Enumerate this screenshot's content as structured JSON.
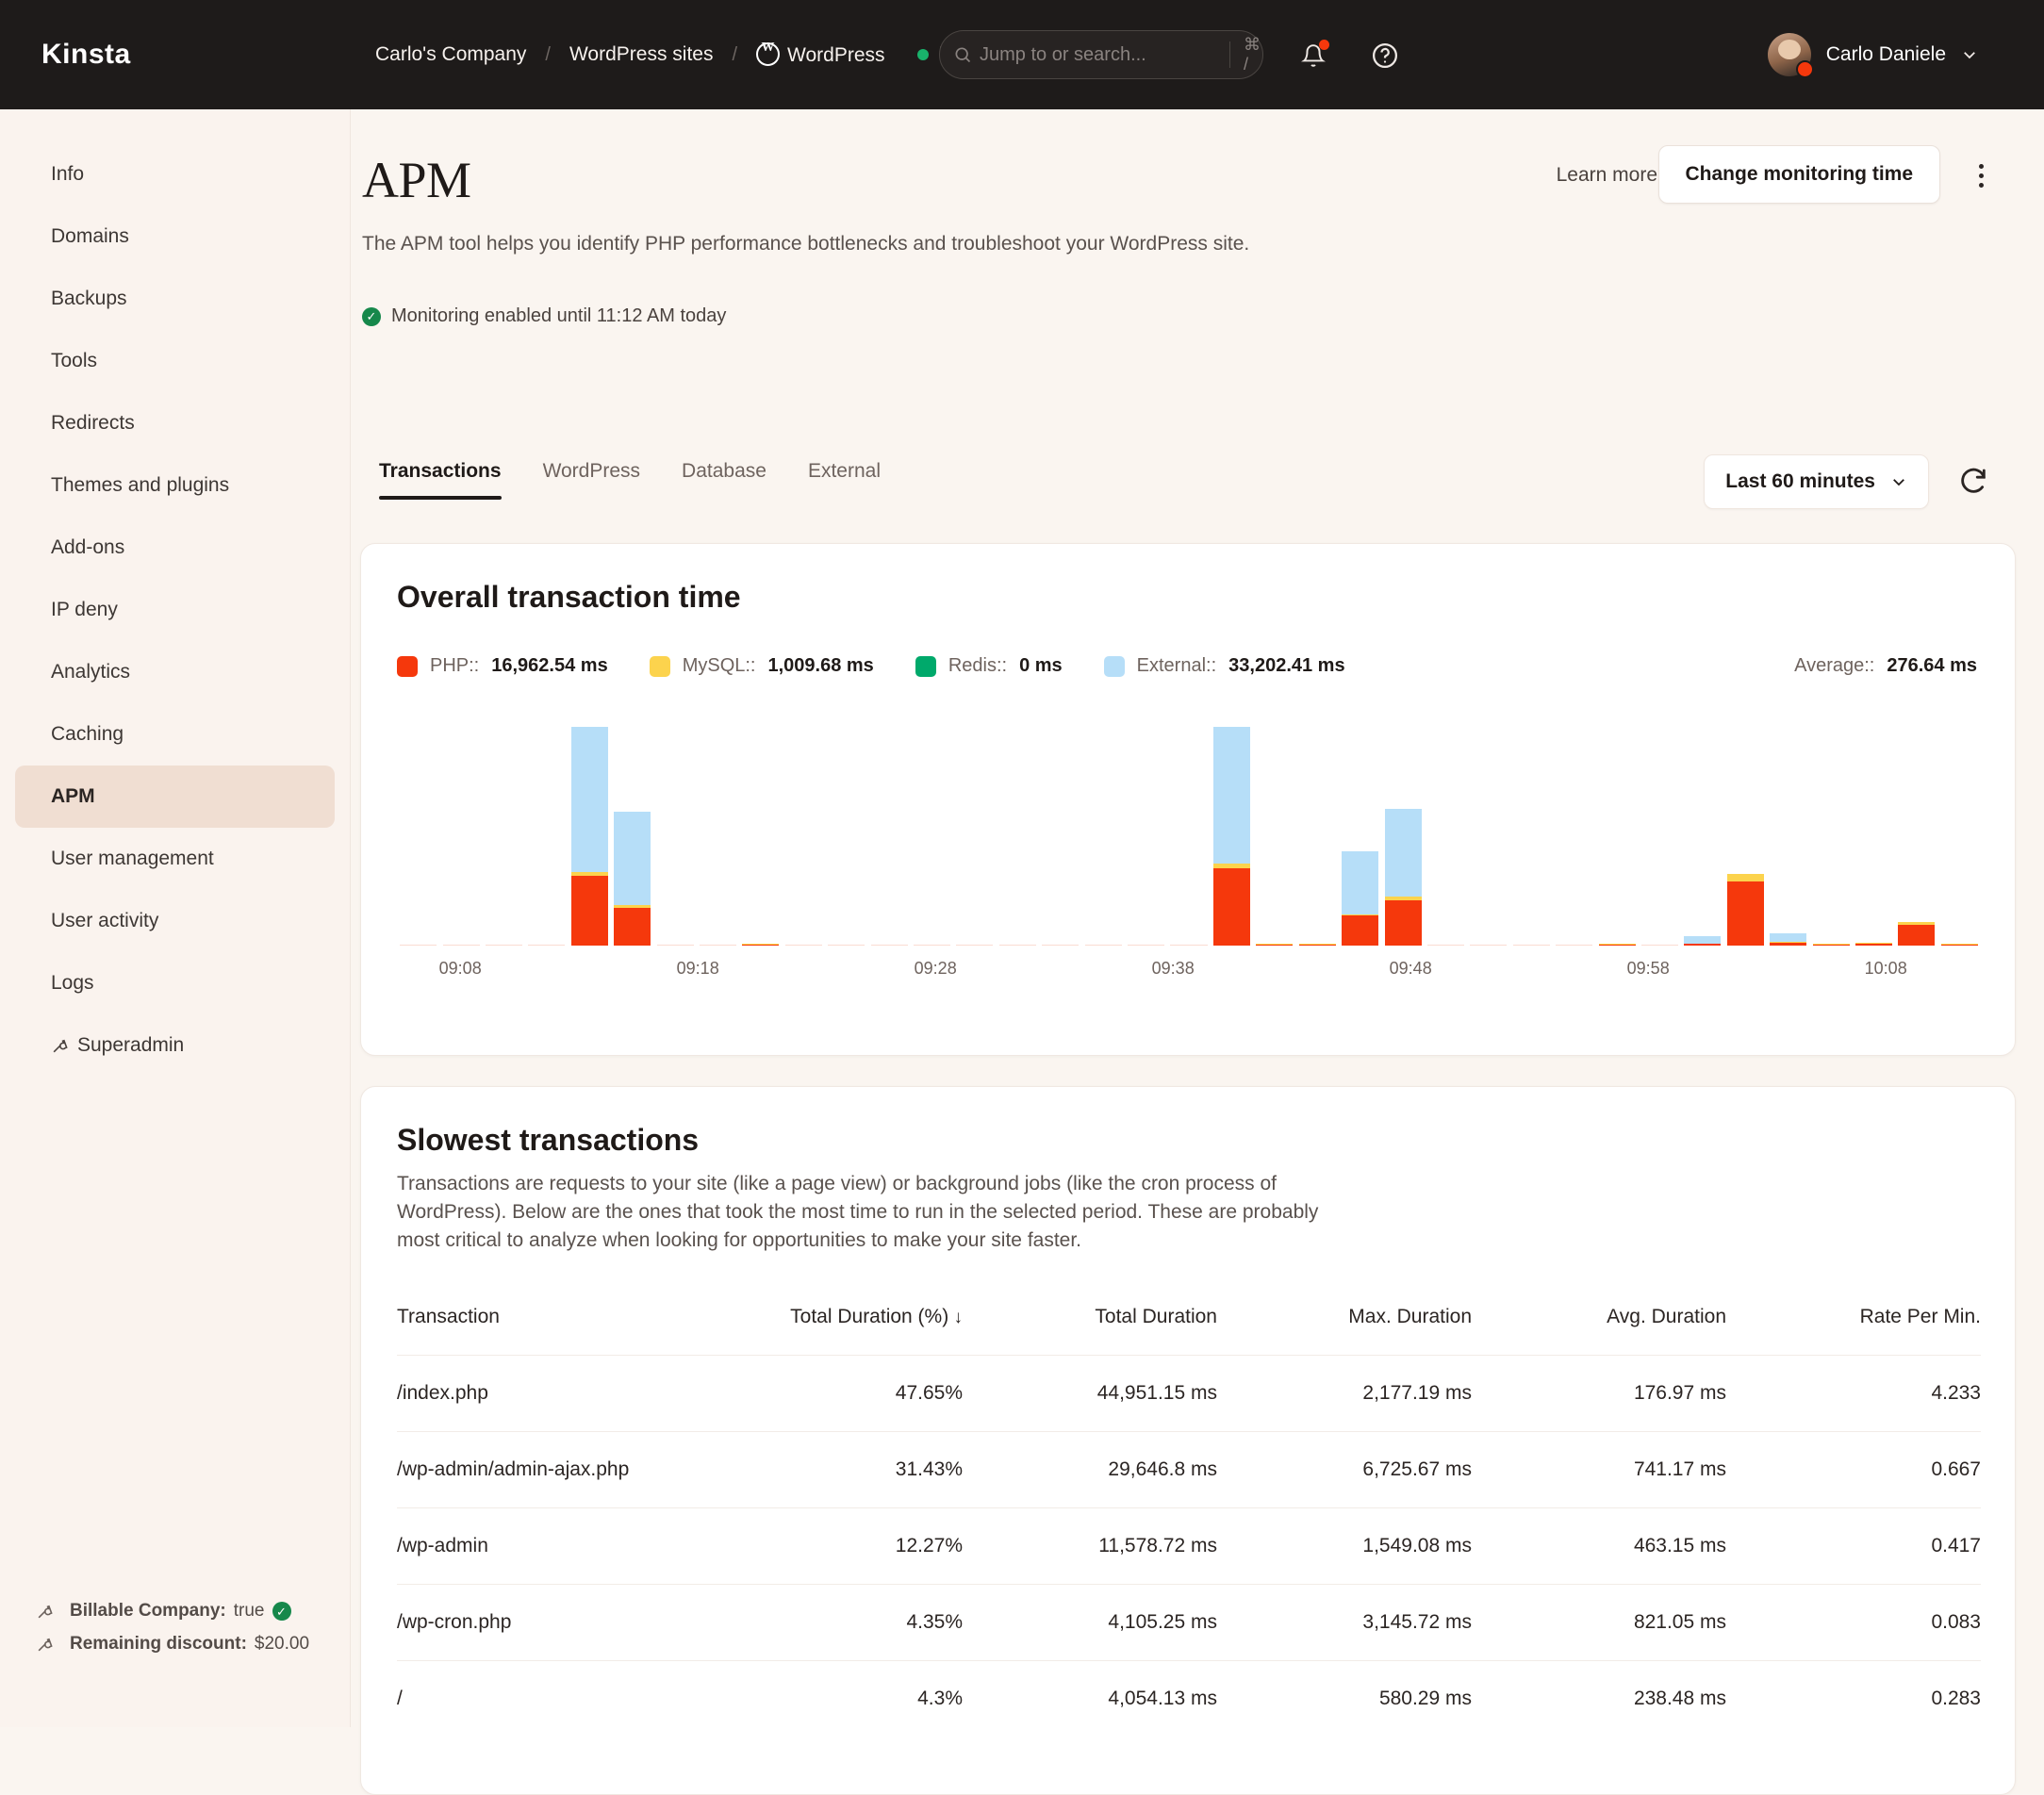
{
  "topbar": {
    "logo": "Kinsta",
    "breadcrumb": [
      {
        "label": "Carlo's Company",
        "icon": null
      },
      {
        "label": "WordPress sites",
        "icon": null
      },
      {
        "label": "WordPress",
        "icon": "wordpress-icon"
      }
    ],
    "status": "Live",
    "status_color": "#19B26B",
    "search_placeholder": "Jump to or search...",
    "search_value": "",
    "search_shortcut": "⌘ /",
    "user_name": "Carlo Daniele",
    "icons": [
      "search-icon",
      "bell-icon",
      "help-icon",
      "chevron-down-icon"
    ]
  },
  "sidebar": {
    "items": [
      {
        "label": "Info",
        "active": false,
        "icon": null
      },
      {
        "label": "Domains",
        "active": false,
        "icon": null
      },
      {
        "label": "Backups",
        "active": false,
        "icon": null
      },
      {
        "label": "Tools",
        "active": false,
        "icon": null
      },
      {
        "label": "Redirects",
        "active": false,
        "icon": null
      },
      {
        "label": "Themes and plugins",
        "active": false,
        "icon": null
      },
      {
        "label": "Add-ons",
        "active": false,
        "icon": null
      },
      {
        "label": "IP deny",
        "active": false,
        "icon": null
      },
      {
        "label": "Analytics",
        "active": false,
        "icon": null
      },
      {
        "label": "Caching",
        "active": false,
        "icon": null
      },
      {
        "label": "APM",
        "active": true,
        "icon": null
      },
      {
        "label": "User management",
        "active": false,
        "icon": null
      },
      {
        "label": "User activity",
        "active": false,
        "icon": null
      },
      {
        "label": "Logs",
        "active": false,
        "icon": null
      },
      {
        "label": "Superadmin",
        "active": false,
        "icon": "wrench-icon"
      }
    ],
    "footer": {
      "billable_key": "Billable Company:",
      "billable_value": "true",
      "discount_key": "Remaining discount:",
      "discount_value": "$20.00"
    }
  },
  "page": {
    "title": "APM",
    "description": "The APM tool helps you identify PHP performance bottlenecks and troubleshoot your WordPress site.",
    "monitoring_status": "Monitoring enabled until 11:12 AM today",
    "learn_more": "Learn more",
    "change_monitoring_button": "Change monitoring time",
    "tabs": [
      {
        "label": "Transactions",
        "active": true
      },
      {
        "label": "WordPress",
        "active": false
      },
      {
        "label": "Database",
        "active": false
      },
      {
        "label": "External",
        "active": false
      }
    ],
    "time_range": "Last 60 minutes"
  },
  "chart_card": {
    "title": "Overall transaction time",
    "average_label": "Average::",
    "average_value": "276.64 ms"
  },
  "table_card": {
    "title": "Slowest transactions",
    "description": "Transactions are requests to your site (like a page view) or background jobs (like the cron process of WordPress). Below are the ones that took the most time to run in the selected period. These are probably most critical to analyze when looking for opportunities to make your site faster.",
    "columns": [
      "Transaction",
      "Total Duration (%)",
      "Total Duration",
      "Max. Duration",
      "Avg. Duration",
      "Rate Per Min."
    ],
    "sorted_column": 1,
    "sort_arrow": "↓",
    "rows": [
      {
        "transaction": "/index.php",
        "total_pct": "47.65%",
        "total_duration": "44,951.15 ms",
        "max_duration": "2,177.19 ms",
        "avg_duration": "176.97 ms",
        "rate_per_min": "4.233"
      },
      {
        "transaction": "/wp-admin/admin-ajax.php",
        "total_pct": "31.43%",
        "total_duration": "29,646.8 ms",
        "max_duration": "6,725.67 ms",
        "avg_duration": "741.17 ms",
        "rate_per_min": "0.667"
      },
      {
        "transaction": "/wp-admin",
        "total_pct": "12.27%",
        "total_duration": "11,578.72 ms",
        "max_duration": "1,549.08 ms",
        "avg_duration": "463.15 ms",
        "rate_per_min": "0.417"
      },
      {
        "transaction": "/wp-cron.php",
        "total_pct": "4.35%",
        "total_duration": "4,105.25 ms",
        "max_duration": "3,145.72 ms",
        "avg_duration": "821.05 ms",
        "rate_per_min": "0.083"
      },
      {
        "transaction": "/",
        "total_pct": "4.3%",
        "total_duration": "4,054.13 ms",
        "max_duration": "580.29 ms",
        "avg_duration": "238.48 ms",
        "rate_per_min": "0.283"
      }
    ]
  },
  "chart_data": {
    "type": "bar",
    "stacked": true,
    "title": "Overall transaction time",
    "xlabel": "",
    "ylabel": "",
    "grid": false,
    "legend_position": "top-left",
    "ylim": [
      0,
      300
    ],
    "xticks": [
      "09:08",
      "09:18",
      "09:28",
      "09:38",
      "09:48",
      "09:58",
      "10:08"
    ],
    "xtick_positions_pct": [
      4,
      19,
      34,
      49,
      64,
      79,
      94
    ],
    "legend": [
      {
        "name": "PHP::",
        "value": "16,962.54 ms",
        "color": "#F5380C"
      },
      {
        "name": "MySQL::",
        "value": "1,009.68 ms",
        "color": "#FCD34D"
      },
      {
        "name": "Redis::",
        "value": "0 ms",
        "color": "#00A96B"
      },
      {
        "name": "External::",
        "value": "33,202.41 ms",
        "color": "#B6DEF8"
      }
    ],
    "series": [
      {
        "name": "PHP",
        "color": "#F5380C",
        "values": [
          0,
          0,
          0,
          0,
          93,
          50,
          0,
          0,
          1.5,
          0,
          0,
          0,
          0,
          0,
          0,
          0,
          0,
          0,
          0,
          103,
          1.2,
          1.2,
          40,
          60,
          0,
          0,
          0,
          0,
          1.5,
          0,
          2.5,
          85,
          4,
          0.6,
          3,
          28,
          1.2
        ]
      },
      {
        "name": "MySQL",
        "color": "#FCD34D",
        "values": [
          0,
          0,
          0,
          0,
          5,
          3.5,
          0,
          0,
          1.0,
          0,
          0,
          0,
          0,
          0,
          0,
          0,
          0,
          0,
          0,
          6,
          0.5,
          0.5,
          1.5,
          5,
          0,
          0,
          0,
          0,
          0.5,
          0,
          0.5,
          10,
          0.5,
          0.3,
          0.5,
          3,
          0.5
        ]
      },
      {
        "name": "Redis",
        "color": "#00A96B",
        "values": [
          0,
          0,
          0,
          0,
          0,
          0,
          0,
          0,
          0,
          0,
          0,
          0,
          0,
          0,
          0,
          0,
          0,
          0,
          0,
          0,
          0,
          0,
          0,
          0,
          0,
          0,
          0,
          0,
          0,
          0,
          0,
          0,
          0,
          0,
          0,
          0,
          0
        ]
      },
      {
        "name": "External",
        "color": "#B6DEF8",
        "values": [
          0,
          0,
          0,
          0,
          192,
          124,
          0,
          0,
          0,
          0,
          0,
          0,
          0,
          0,
          0,
          0,
          0,
          0,
          0,
          181,
          0,
          0,
          83,
          116,
          0,
          0,
          0,
          0,
          0,
          0,
          9,
          0,
          12,
          0,
          0,
          0,
          0
        ]
      }
    ]
  }
}
